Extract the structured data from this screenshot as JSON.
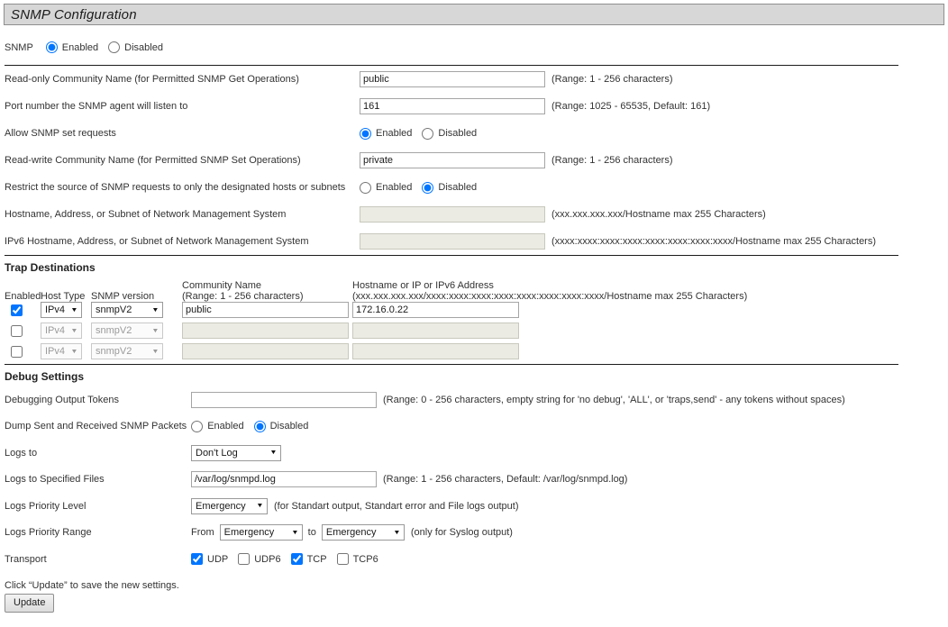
{
  "title": "SNMP Configuration",
  "radio_labels": {
    "enabled": "Enabled",
    "disabled": "Disabled"
  },
  "snmp": {
    "label": "SNMP",
    "enabled_checked": true,
    "disabled_checked": false
  },
  "general": {
    "read_only_community": {
      "label": "Read-only Community Name (for Permitted SNMP Get Operations)",
      "value": "public",
      "hint": "(Range: 1 - 256 characters)"
    },
    "port": {
      "label": "Port number the SNMP agent will listen to",
      "value": "161",
      "hint": "(Range: 1025 - 65535, Default: 161)"
    },
    "allow_set": {
      "label": "Allow SNMP set requests",
      "enabled_checked": true,
      "disabled_checked": false
    },
    "read_write_community": {
      "label": "Read-write Community Name (for Permitted SNMP Set Operations)",
      "value": "private",
      "hint": "(Range: 1 - 256 characters)"
    },
    "restrict_source": {
      "label": "Restrict the source of SNMP requests to only the designated hosts or subnets",
      "enabled_checked": false,
      "disabled_checked": true
    },
    "nms_host": {
      "label": "Hostname, Address, or Subnet of Network Management System",
      "value": "",
      "hint": "(xxx.xxx.xxx.xxx/Hostname max 255 Characters)"
    },
    "nms_host_v6": {
      "label": "IPv6 Hostname, Address, or Subnet of Network Management System",
      "value": "",
      "hint": "(xxxx:xxxx:xxxx:xxxx:xxxx:xxxx:xxxx:xxxx/Hostname max 255 Characters)"
    }
  },
  "trap_destinations": {
    "heading": "Trap Destinations",
    "columns": {
      "enabled": "Enabled",
      "host_type": "Host Type",
      "snmp_version": "SNMP version",
      "community_line1": "Community Name",
      "community_line2": "(Range: 1 - 256 characters)",
      "hostname_line1": "Hostname or IP or IPv6 Address",
      "hostname_line2": "(xxx.xxx.xxx.xxx/xxxx:xxxx:xxxx:xxxx:xxxx:xxxx:xxxx:xxxx/Hostname max 255 Characters)"
    },
    "rows": [
      {
        "enabled": true,
        "host_type": "IPv4",
        "snmp_version": "snmpV2",
        "community": "public",
        "hostname": "172.16.0.22"
      },
      {
        "enabled": false,
        "host_type": "IPv4",
        "snmp_version": "snmpV2",
        "community": "",
        "hostname": ""
      },
      {
        "enabled": false,
        "host_type": "IPv4",
        "snmp_version": "snmpV2",
        "community": "",
        "hostname": ""
      }
    ]
  },
  "debug": {
    "heading": "Debug Settings",
    "output_tokens": {
      "label": "Debugging Output Tokens",
      "value": "",
      "hint": "(Range: 0 - 256 characters, empty string for 'no debug', 'ALL', or 'traps,send' - any tokens without spaces)"
    },
    "dump_packets": {
      "label": "Dump Sent and Received SNMP Packets",
      "enabled_checked": false,
      "disabled_checked": true
    },
    "logs_to": {
      "label": "Logs to",
      "value": "Don't Log"
    },
    "logs_file": {
      "label": "Logs to Specified Files",
      "value": "/var/log/snmpd.log",
      "hint": "(Range: 1 - 256 characters, Default: /var/log/snmpd.log)"
    },
    "priority_level": {
      "label": "Logs Priority Level",
      "value": "Emergency",
      "hint": "(for Standart output, Standart error and File logs output)"
    },
    "priority_range": {
      "label": "Logs Priority Range",
      "from_label": "From",
      "from_value": "Emergency",
      "to_label": "to",
      "to_value": "Emergency",
      "hint": "(only for Syslog output)"
    },
    "transport": {
      "label": "Transport",
      "options": [
        {
          "label": "UDP",
          "checked": true
        },
        {
          "label": "UDP6",
          "checked": false
        },
        {
          "label": "TCP",
          "checked": true
        },
        {
          "label": "TCP6",
          "checked": false
        }
      ]
    }
  },
  "footer": {
    "note": "Click “Update” to save the new settings.",
    "update_button": "Update"
  }
}
